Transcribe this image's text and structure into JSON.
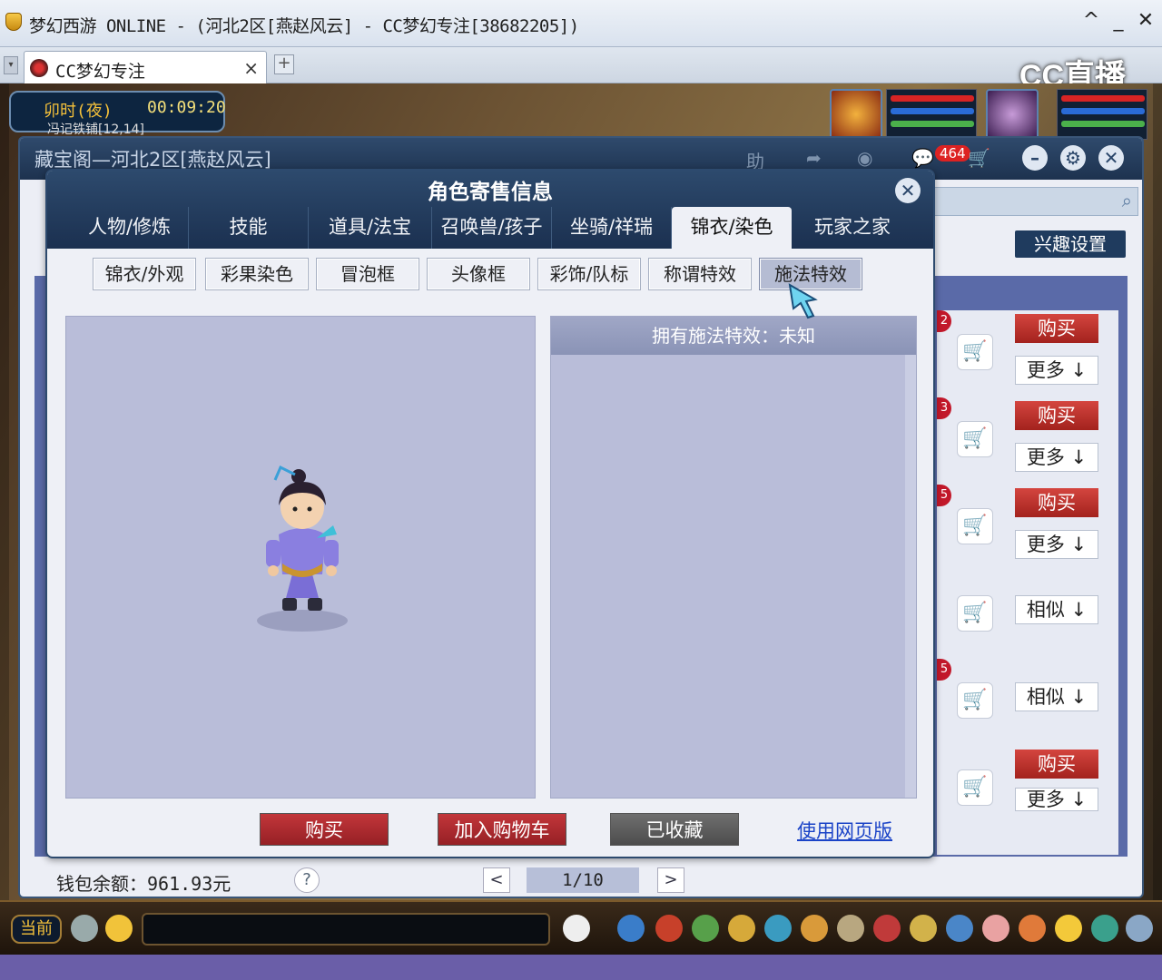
{
  "window": {
    "title": "梦幻西游 ONLINE - (河北2区[燕赵风云] - CC梦幻专注[38682205])",
    "controls": {
      "collapse": "^",
      "minimize": "_",
      "close": "✕"
    }
  },
  "browser_tab": {
    "label": "CC梦幻专注",
    "close": "×",
    "new_tab": "+"
  },
  "watermark": "CC直播",
  "game_hud": {
    "time_label": "卯时(夜)",
    "timer": "00:09:20",
    "location": "冯记铁铺[12,14]"
  },
  "cbg": {
    "title": "藏宝阁—河北2区[燕赵风云]",
    "help_icon": "助",
    "badge_count": "464",
    "interest_button": "兴趣设置",
    "rows": [
      {
        "num": "2",
        "primary": "购买",
        "secondary": "更多"
      },
      {
        "num": "3",
        "primary": "购买",
        "secondary": "更多"
      },
      {
        "num": "5",
        "primary": "购买",
        "secondary": "更多"
      },
      {
        "num": "",
        "primary": "",
        "secondary": "相似"
      },
      {
        "num": "5",
        "primary": "",
        "secondary": "相似"
      },
      {
        "num": "",
        "primary": "购买",
        "secondary": "更多"
      }
    ],
    "wallet": "钱包余额：961.93元",
    "help_btn": "?",
    "pagination": {
      "prev": "<",
      "page": "1/10",
      "next": ">"
    }
  },
  "modal": {
    "title": "角色寄售信息",
    "close": "✕",
    "tabs": [
      "人物/修炼",
      "技能",
      "道具/法宝",
      "召唤兽/孩子",
      "坐骑/祥瑞",
      "锦衣/染色",
      "玩家之家"
    ],
    "active_tab": "锦衣/染色",
    "subtabs": [
      "锦衣/外观",
      "彩果染色",
      "冒泡框",
      "头像框",
      "彩饰/队标",
      "称谓特效",
      "施法特效"
    ],
    "active_subtab": "施法特效",
    "effect_header": "拥有施法特效：未知",
    "actions": {
      "buy": "购买",
      "add_cart": "加入购物车",
      "favorited": "已收藏",
      "web_version": "使用网页版"
    }
  },
  "bottom_hud": {
    "channel": "当前"
  },
  "colors": {
    "accent_red": "#c2363a",
    "header_blue": "#1d324f",
    "panel_lavender": "#b9bdd9",
    "link_blue": "#1a43c7"
  }
}
